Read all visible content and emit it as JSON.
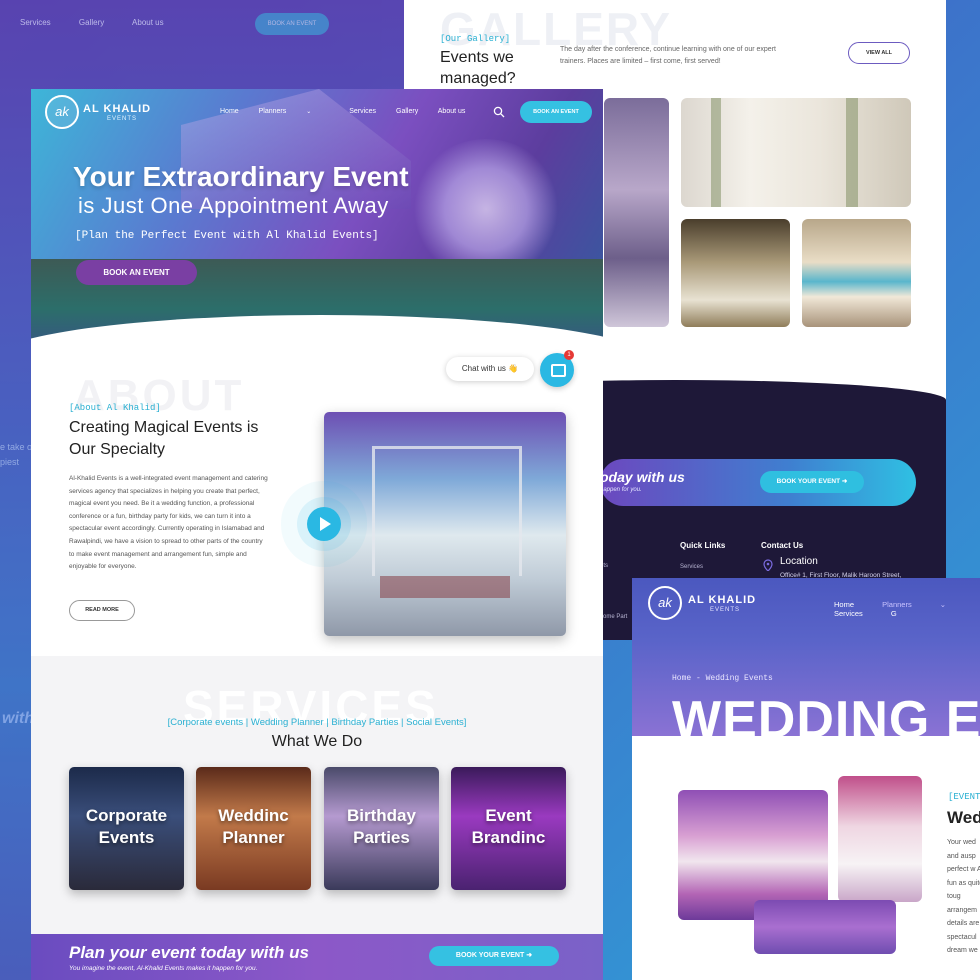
{
  "back_left": {
    "nav": [
      "Services",
      "Gallery",
      "About us"
    ],
    "book_label": "BOOK AN EVENT",
    "ghost_text": "e take ons- piest",
    "cta_fragment": "with"
  },
  "gallery": {
    "ghost": "GALLERY",
    "tag": "[Our Gallery]",
    "title": "Events we managed?",
    "description": "The day after the conference, continue learning with one of our expert trainers. Places are limited – first come, first served!",
    "view_all": "VIEW ALL",
    "cta_title": "oday with us",
    "cta_sub": "happen for you.",
    "cta_button": "BOOK YOUR EVENT",
    "quick_links": "Quick Links",
    "quick_item": "Services",
    "contact": "Contact Us",
    "location_label": "Location",
    "location_value": "Office# 1, First Floor, Malik Haroon Street,",
    "cut_items": [
      "nts",
      "s",
      "s",
      "come Part"
    ]
  },
  "wedding": {
    "brand": "AL KHALID",
    "brand_sub": "EVENTS",
    "nav": [
      "Home",
      "Planners",
      "Services",
      "G"
    ],
    "breadcrumb": "Home - Wedding Events",
    "big_title": "WEDDING E",
    "tag": "[EVENT",
    "heading": "Wed",
    "text": "Your wed and ausp perfect w As fun as quite toug arrangem details are spectacul dream we"
  },
  "main": {
    "logo_glyph": "ak",
    "brand": "AL KHALID",
    "brand_sub": "EVENTS",
    "nav": [
      "Home",
      "Planners",
      "Services",
      "Gallery",
      "About us"
    ],
    "book_label": "BOOK AN EVENT",
    "hero_line1": "Your Extraordinary Event",
    "hero_line2": "is Just One Appointment Away",
    "hero_line3": "[Plan the Perfect Event with Al Khalid Events]",
    "hero_button": "BOOK AN EVENT",
    "chat_label": "Chat with us 👋",
    "chat_badge": "1",
    "about_ghost": "ABOUT",
    "about_tag": "[About Al Khalid]",
    "about_heading": "Creating Magical Events is Our Specialty",
    "about_text": "Al-Khalid Events is a well-integrated event management and catering services agency that specializes in helping you create that perfect, magical event you need. Be it a wedding function, a professional conference or a fun, birthday party for kids, we can turn it into a spectacular event accordingly. Currently operating in Islamabad and Rawalpindi, we have a vision to spread to other parts of the country to make event management and arrangement fun, simple and enjoyable for everyone.",
    "read_more": "READ MORE",
    "services_ghost": "SERVICES",
    "services_tag": "[Corporate events | Wedding Planner | Birthday Parties | Social Events]",
    "services_heading": "What We Do",
    "cards": [
      "Corporate\nEvents",
      "Weddinc\nPlanner",
      "Birthday\nParties",
      "Event\nBrandinc"
    ],
    "cta_title": "Plan your event today with us",
    "cta_sub": "You imagine the event, Al-Khalid Events makes it happen for you.",
    "cta_button": "BOOK YOUR EVENT ➜"
  },
  "colors": {
    "accent_cyan": "#35c1e2",
    "accent_purple": "#7a3fa3",
    "dark_footer": "#1e1838"
  }
}
